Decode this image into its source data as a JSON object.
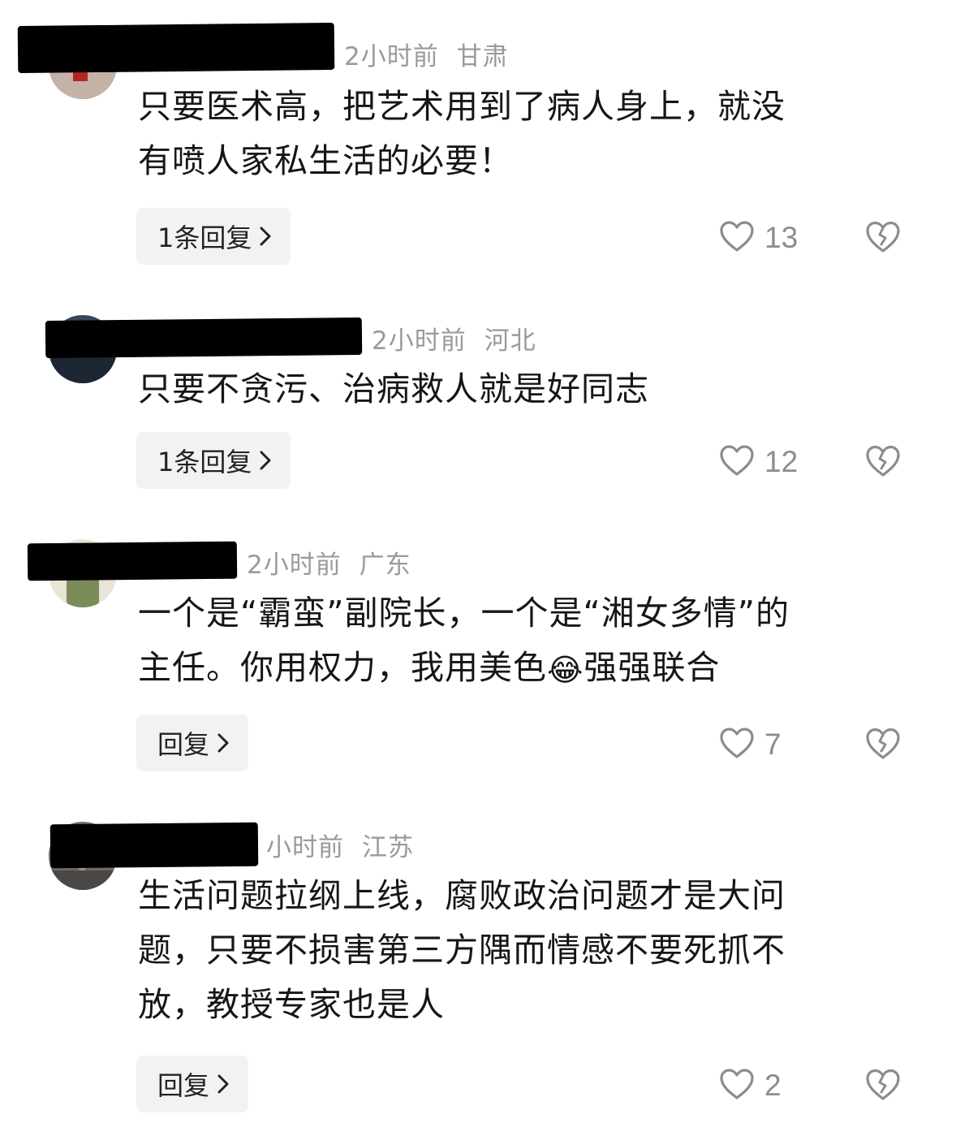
{
  "comments": [
    {
      "time": "2小时前",
      "location": "甘肃",
      "text_lines": [
        "只要医术高，把艺术用到了病人身上，就没",
        "有喷人家私生活的必要！"
      ],
      "reply_label": "1条回复",
      "likes": "13",
      "avatar_colors": [
        "#6b5a52",
        "#c4b2a6",
        "#b8251f"
      ]
    },
    {
      "time": "2小时前",
      "location": "河北",
      "text_lines": [
        "只要不贪污、治病救人就是好同志"
      ],
      "reply_label": "1条回复",
      "likes": "12",
      "avatar_colors": [
        "#36475a",
        "#8ea0b6",
        "#1d2633"
      ]
    },
    {
      "time": "2小时前",
      "location": "广东",
      "text_lines": [
        "一个是“霸蛮”副院长，一个是“湘女多情”的",
        "主任。你用权力，我用美色",
        "强强联合"
      ],
      "emoji": "😂",
      "reply_label": "回复",
      "likes": "7",
      "avatar_colors": [
        "#e9e4d6",
        "#7b8c5a",
        "#b09070"
      ]
    },
    {
      "time": "小时前",
      "location": "江苏",
      "text_lines": [
        "生活问题拉纲上线，腐败政治问题才是大问",
        "题，只要不损害第三方隅而情感不要死抓不",
        "放，教授专家也是人"
      ],
      "reply_label": "回复",
      "likes": "2",
      "avatar_colors": [
        "#6e6a66",
        "#9a948e",
        "#4a4744"
      ]
    }
  ],
  "icons": {
    "like": "heart-outline-icon",
    "dislike": "broken-heart-icon",
    "chevron": "chevron-right-icon"
  }
}
